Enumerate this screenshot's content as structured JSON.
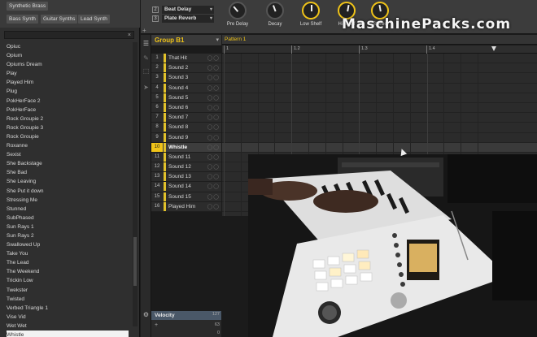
{
  "browser": {
    "tags": [
      {
        "label": "Synthetic Brass"
      },
      {
        "label": "Bass Synth"
      },
      {
        "label": "Guitar Synths"
      },
      {
        "label": "Lead Synth"
      }
    ],
    "search_clear": "×",
    "presets": [
      "Opiuc",
      "Opium",
      "Opiums Dream",
      "Play",
      "Played Him",
      "Plug",
      "PokHerFace 2",
      "PokHerFace",
      "Rock Groupie 2",
      "Rock Groupie 3",
      "Rock Groupie",
      "Roxanne",
      "Sexist",
      "She Backstage",
      "She Bad",
      "She Leaving",
      "She Put it down",
      "Stressing Me",
      "Stunned",
      "SubPhased",
      "Sun Rays 1",
      "Sun Rays 2",
      "Swallowed Up",
      "Take You",
      "The Lead",
      "The Weekend",
      "Trickin Low",
      "Twekster",
      "Twisted",
      "Verbed Triangle 1",
      "Vise Vid",
      "Wet Wet",
      "Whistle"
    ],
    "selected_preset": "Whistle"
  },
  "module": {
    "fx_slots": [
      {
        "index": "2",
        "name": "Beat Delay"
      },
      {
        "index": "3",
        "name": "Plate Reverb"
      }
    ],
    "fx_add": "+",
    "knobs": [
      {
        "label": "Pre Delay",
        "active": false
      },
      {
        "label": "Decay",
        "active": false
      },
      {
        "label": "Low Shelf",
        "active": true
      },
      {
        "label": "Hi Shelf",
        "active": true
      },
      {
        "label": "Stereo",
        "active": true
      }
    ]
  },
  "watermark": "MaschinePacks.com",
  "group": {
    "name": "Group B1",
    "menu_icon": "▾"
  },
  "pattern": {
    "name": "Pattern 1",
    "ruler": [
      "1",
      "1.2",
      "1.3",
      "1.4"
    ]
  },
  "sounds": [
    {
      "num": "1",
      "name": "That Hit"
    },
    {
      "num": "2",
      "name": "Sound 2"
    },
    {
      "num": "3",
      "name": "Sound 3"
    },
    {
      "num": "4",
      "name": "Sound 4"
    },
    {
      "num": "5",
      "name": "Sound 5"
    },
    {
      "num": "6",
      "name": "Sound 6"
    },
    {
      "num": "7",
      "name": "Sound 7"
    },
    {
      "num": "8",
      "name": "Sound 8"
    },
    {
      "num": "9",
      "name": "Sound 9"
    },
    {
      "num": "10",
      "name": "Whistle",
      "selected": true
    },
    {
      "num": "11",
      "name": "Sound 11"
    },
    {
      "num": "12",
      "name": "Sound 12"
    },
    {
      "num": "13",
      "name": "Sound 13"
    },
    {
      "num": "14",
      "name": "Sound 14"
    },
    {
      "num": "15",
      "name": "Sound 15"
    },
    {
      "num": "16",
      "name": "Played Him"
    }
  ],
  "velocity": {
    "label": "Velocity",
    "max": "127",
    "mid": "63",
    "min": "0",
    "plus": "+"
  },
  "colors": {
    "accent_yellow": "#f0c419",
    "sound_color": "#e1c12a",
    "velocity_bar": "#4a5868"
  }
}
